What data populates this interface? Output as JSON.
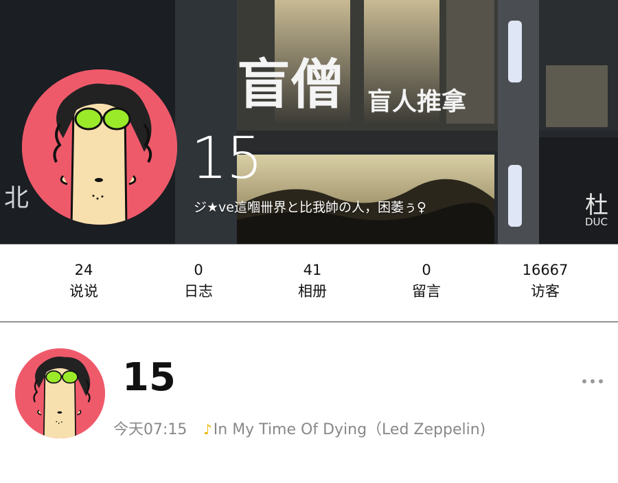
{
  "profile": {
    "name": "15",
    "bio": "ジ★ve這嗰卌界と比我帥の人，困萎ぅ♀"
  },
  "stats": [
    {
      "count": "24",
      "label": "说说"
    },
    {
      "count": "0",
      "label": "日志"
    },
    {
      "count": "41",
      "label": "相册"
    },
    {
      "count": "0",
      "label": "留言"
    },
    {
      "count": "16667",
      "label": "访客"
    }
  ],
  "post": {
    "author": "15",
    "time": "今天07:15",
    "music_icon": "♪",
    "music": "In My Time Of Dying（Led Zeppelin)"
  },
  "icons": {
    "more": "more-dots-icon",
    "music": "music-note-icon"
  },
  "colors": {
    "avatar_bg": "#ef5a6b",
    "glasses": "#9bea2a",
    "music_accent": "#f0b400"
  }
}
